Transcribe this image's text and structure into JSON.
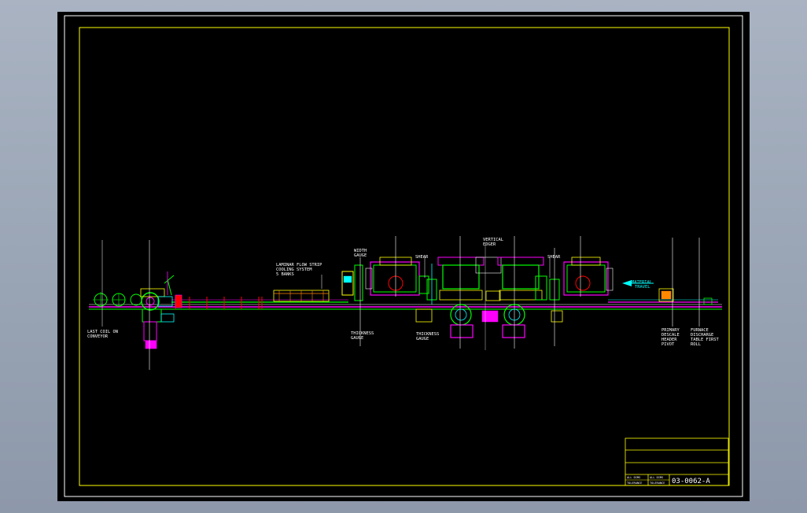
{
  "labels": {
    "last_coil_line1": "LAST COIL ON",
    "last_coil_line2": "CONVEYOR",
    "laminar_line1": "LAMINAR FLOW STRIP",
    "laminar_line2": "COOLING SYSTEM",
    "laminar_line3": "5 BANKS",
    "width_gauge_line1": "WIDTH",
    "width_gauge_line2": "GAUGE",
    "thickness1_line1": "THICKNESS",
    "thickness1_line2": "GAUGE",
    "shear_left": "SHEAR",
    "thickness2_line1": "THICKNESS",
    "thickness2_line2": "GAUGE",
    "vertical_edger_line1": "VERTICAL",
    "vertical_edger_line2": "EDGER",
    "shear_right": "SHEAR",
    "material_travel_line1": "MATERIAL",
    "material_travel_line2": "TRAVEL",
    "primary_line1": "PRIMARY",
    "primary_line2": "DESCALE",
    "primary_line3": "HEADER",
    "primary_line4": "PIVOT",
    "furnace_line1": "FURNACE",
    "furnace_line2": "DISCHARGE",
    "furnace_line3": "TABLE FIRST",
    "furnace_line4": "ROLL"
  },
  "title_block": {
    "drawing_number": "03-0062-A",
    "cell_1": "ALL DIMS",
    "cell_2": "ALL DIMS",
    "cell_3": "TOLERANCE",
    "cell_4": "TOLERANCE"
  },
  "colors": {
    "background": "#000000",
    "frame": "#ffff00",
    "equipment_primary": "#00ff00",
    "equipment_secondary": "#ff00ff",
    "annotation": "#ffffff",
    "accent": "#00ffff"
  }
}
